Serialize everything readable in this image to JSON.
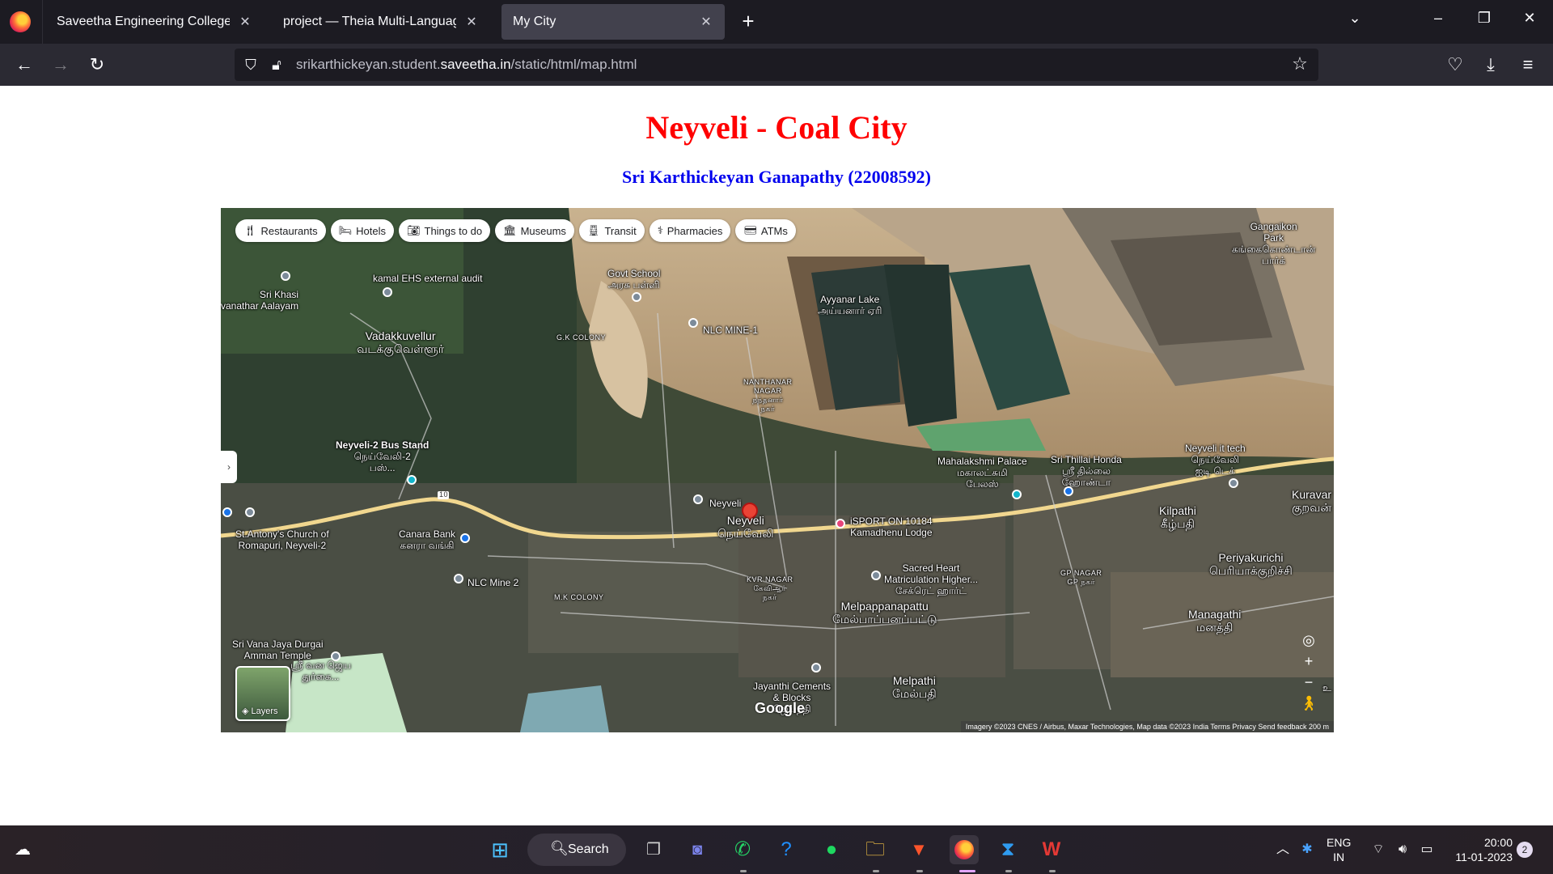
{
  "browser": {
    "tabs": [
      {
        "title": "Saveetha Engineering College",
        "close": "✕"
      },
      {
        "title": "project — Theia Multi-Language Ex",
        "close": "✕"
      },
      {
        "title": "My City",
        "close": "✕"
      }
    ],
    "new_tab": "+",
    "url_host_pre": "srikarthickeyan.student.",
    "url_host_main": "saveetha.in",
    "url_path": "/static/html/map.html"
  },
  "page": {
    "title": "Neyveli - Coal City",
    "subtitle": "Sri Karthickeyan Ganapathy (22008592)"
  },
  "map": {
    "chips": [
      "Restaurants",
      "Hotels",
      "Things to do",
      "Museums",
      "Transit",
      "Pharmacies",
      "ATMs"
    ],
    "labels": {
      "govt_school": "Govt School",
      "govt_school_ta": "அரசு பள்ளி",
      "ayyanar_lake": "Ayyanar Lake",
      "ayyanar_lake_ta": "அய்யனார் ஏரி",
      "nlc_mine1": "NLC MINE-1",
      "gk_colony": "G.K COLONY",
      "vadakkuvellur": "Vadakkuvellur",
      "vadakkuvellur_ta": "வடக்குவெள்ளூர்",
      "kamal": "kamal EHS external audit",
      "sri_khasi": "Sri Khasi",
      "sri_khasi2": "vanathar Aalayam",
      "nanthanar": "NANTHANAR",
      "nanthanar2": "NAGAR",
      "nanthanar_ta": "நந்தனார்",
      "nanthanar_ta2": "நகர்",
      "gangaikon": "Gangaikon",
      "gangaikon2": "Park",
      "gangaikon_ta": "கங்கைகொண்டான்",
      "gangaikon_ta2": "பார்க்",
      "bus_stand": "Neyveli-2 Bus Stand",
      "bus_stand_ta": "நெய்வேலி-2",
      "bus_stand_ta2": "பஸ்...",
      "mahalakshmi": "Mahalakshmi Palace",
      "mahalakshmi_ta": "மகாலட்சுமி",
      "mahalakshmi_ta2": "பேலஸ்",
      "thillai": "Sri Thillai Honda",
      "thillai_ta": "ஸ்ரீ தில்லை",
      "thillai_ta2": "ஹோண்டா",
      "it_tech": "Neyveli it tech",
      "it_tech_ta": "நெய்வேலி",
      "it_tech_ta2": "ஐடி டெக்",
      "kuravan": "Kuravar",
      "kuravan_ta": "குறவன்",
      "neyveli_small": "Neyveli",
      "neyveli": "Neyveli",
      "neyveli_ta": "நெய்வேலி",
      "kilpathi": "Kilpathi",
      "kilpathi_ta": "கீழ்பதி",
      "st_antony": "St.Antony's Church of",
      "st_antony2": "Romapuri, Neyveli-2",
      "canara": "Canara Bank",
      "canara_ta": "கனரா வங்கி",
      "isports": "iSPORT ON 10184",
      "kamadhenu": "Kamadhenu Lodge",
      "sacred_heart": "Sacred Heart",
      "sacred_heart2": "Matriculation Higher...",
      "sacred_heart_ta": "சேக்ரெட் ஹார்ட்",
      "periyakurichi": "Periyakurichi",
      "periyakurichi_ta": "பெரியாக்குறிச்சி",
      "nlc_mine2": "NLC Mine 2",
      "mk_colony": "M.K COLONY",
      "kvr_nagar": "KVR NAGAR",
      "kvr_nagar_ta": "கேவிஆர்",
      "kvr_nagar_ta2": "நகர்",
      "gp_nagar": "GP NAGAR",
      "gp_nagar_ta": "GP நகர்",
      "melpappanapattu": "Melpappanapattu",
      "melpappanapattu_ta": "மேல்பாப்பனப்பட்டு",
      "managathi": "Managathi",
      "managathi_ta": "மனத்தி",
      "vana_durgai": "Sri Vana Jaya Durgai",
      "vana_durgai2": "Amman Temple",
      "vana_durgai_ta": "ஸ்ரீ வன ஜெய",
      "vana_durgai_ta2": "துர்கை...",
      "melpathi": "Melpathi",
      "melpathi_ta": "மேல்பதி",
      "jayanthi": "Jayanthi Cements",
      "jayanthi2": "& Blocks",
      "jayanthi_ta": "ஜெயந்தி",
      "road_no": "10",
      "u_mark": "உ"
    },
    "layers_label": "Layers",
    "google_logo": "Google",
    "attribution": "Imagery ©2023 CNES / Airbus, Maxar Technologies, Map data ©2023     India     Terms     Privacy     Send feedback     200 m"
  },
  "taskbar": {
    "search_label": "Search",
    "lang_line1": "ENG",
    "lang_line2": "IN",
    "time": "20:00",
    "date": "11-01-2023",
    "notification_count": "2"
  }
}
